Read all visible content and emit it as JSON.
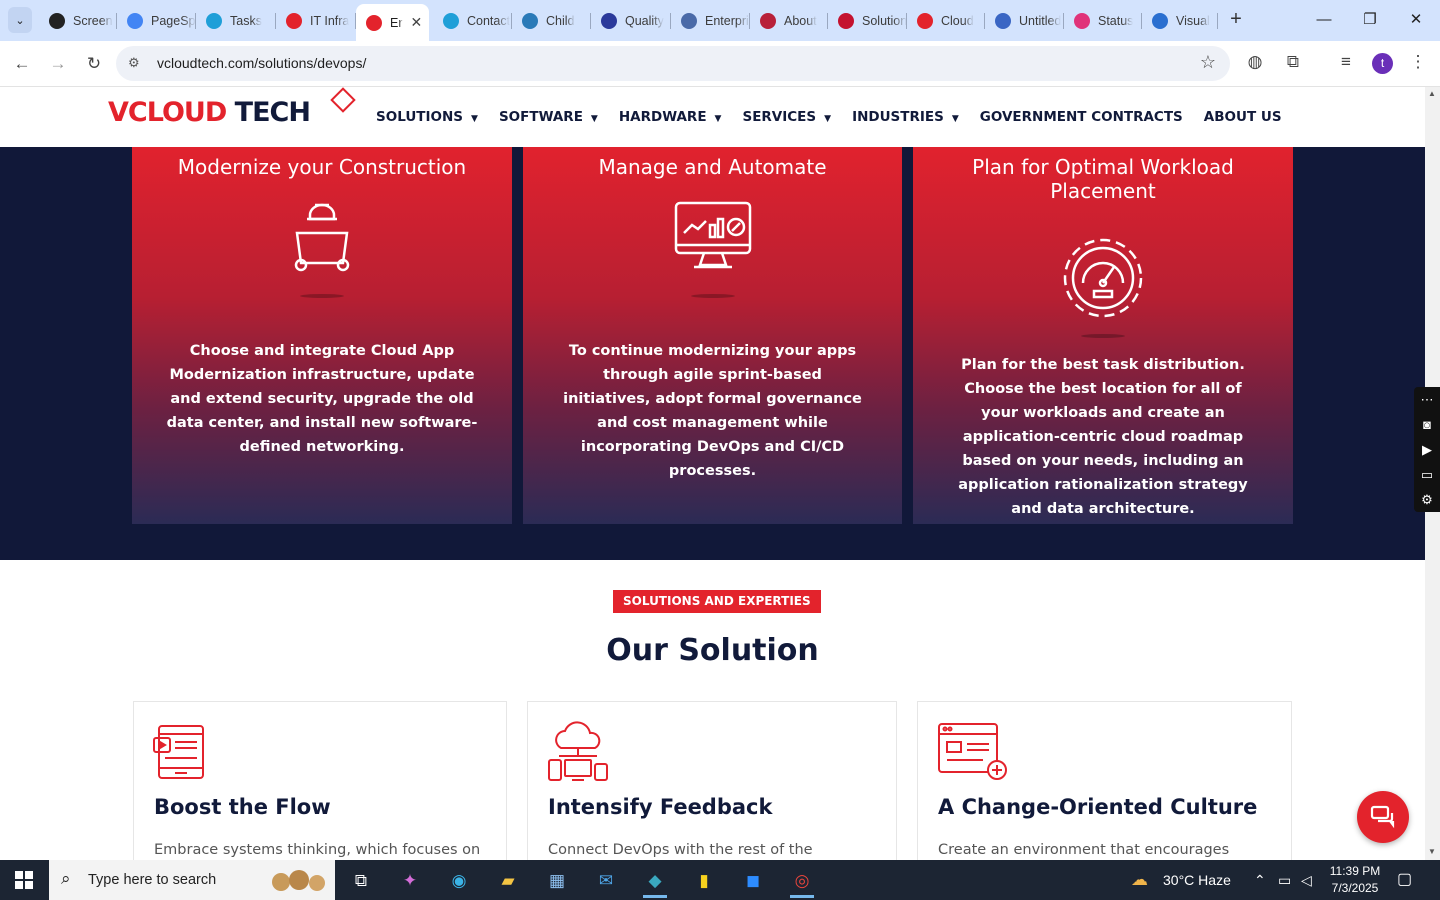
{
  "browser": {
    "tabs": [
      {
        "title": "Screen",
        "color": "#222222"
      },
      {
        "title": "PageSpeed",
        "color": "#4285f4"
      },
      {
        "title": "Tasks",
        "color": "#1f9fd8"
      },
      {
        "title": "IT Infra",
        "color": "#e3232c"
      },
      {
        "title": "Er",
        "color": "#e3232c"
      },
      {
        "title": "Contact",
        "color": "#1f9fd8"
      },
      {
        "title": "Child",
        "color": "#2a7ab8"
      },
      {
        "title": "Quality",
        "color": "#2b3a9b"
      },
      {
        "title": "Enterprise",
        "color": "#4a6aa8"
      },
      {
        "title": "About",
        "color": "#b8203a"
      },
      {
        "title": "Solutions",
        "color": "#c4122f"
      },
      {
        "title": "Cloud",
        "color": "#e3232c"
      },
      {
        "title": "Untitled",
        "color": "#3a66c4"
      },
      {
        "title": "Status",
        "color": "#e0337a"
      },
      {
        "title": "Visual",
        "color": "#2a6fd0"
      }
    ],
    "active_tab_close": "✕",
    "new_tab": "+",
    "url": "vcloudtech.com/solutions/devops/",
    "profile_initial": "t"
  },
  "site": {
    "logo_part1": "VCLOUD",
    "logo_part2": "TECH",
    "menu": [
      "SOLUTIONS",
      "SOFTWARE",
      "HARDWARE",
      "SERVICES",
      "INDUSTRIES",
      "GOVERNMENT CONTRACTS",
      "ABOUT US"
    ],
    "menu_dropdown": [
      true,
      true,
      true,
      true,
      true,
      false,
      false
    ]
  },
  "features": [
    {
      "title": "Modernize your Construction",
      "icon": "engineer-blueprint-icon",
      "text": "Choose and integrate Cloud App Modernization infrastructure, update and extend security, upgrade the old data center, and install new software-defined networking."
    },
    {
      "title": "Manage and Automate",
      "icon": "monitor-analytics-icon",
      "text": "To continue modernizing your apps through agile sprint-based initiatives, adopt formal governance and cost management while incorporating DevOps and CI/CD processes."
    },
    {
      "title": "Plan for Optimal Workload Placement",
      "icon": "gear-speedometer-icon",
      "text": "Plan for the best task distribution. Choose the best location for all of your workloads and create an application-centric cloud roadmap based on your needs, including an application rationalization strategy and data architecture."
    }
  ],
  "solutions_section": {
    "badge": "SOLUTIONS AND EXPERTIES",
    "title": "Our Solution",
    "cards": [
      {
        "title": "Boost the Flow",
        "text": "Embrace systems thinking, which focuses on",
        "icon": "tablet-video-icon"
      },
      {
        "title": "Intensify Feedback",
        "text": "Connect DevOps with the rest of the",
        "icon": "cloud-devices-icon"
      },
      {
        "title": "A Change-Oriented Culture",
        "text": "Create an environment that encourages",
        "icon": "browser-add-icon"
      }
    ]
  },
  "taskbar": {
    "search_placeholder": "Type here to search",
    "weather": "30°C  Haze",
    "time": "11:39 PM",
    "date": "7/3/2025"
  },
  "colors": {
    "brand_red": "#e3232c",
    "navy": "#111a3a",
    "dark_band": "#111839"
  }
}
